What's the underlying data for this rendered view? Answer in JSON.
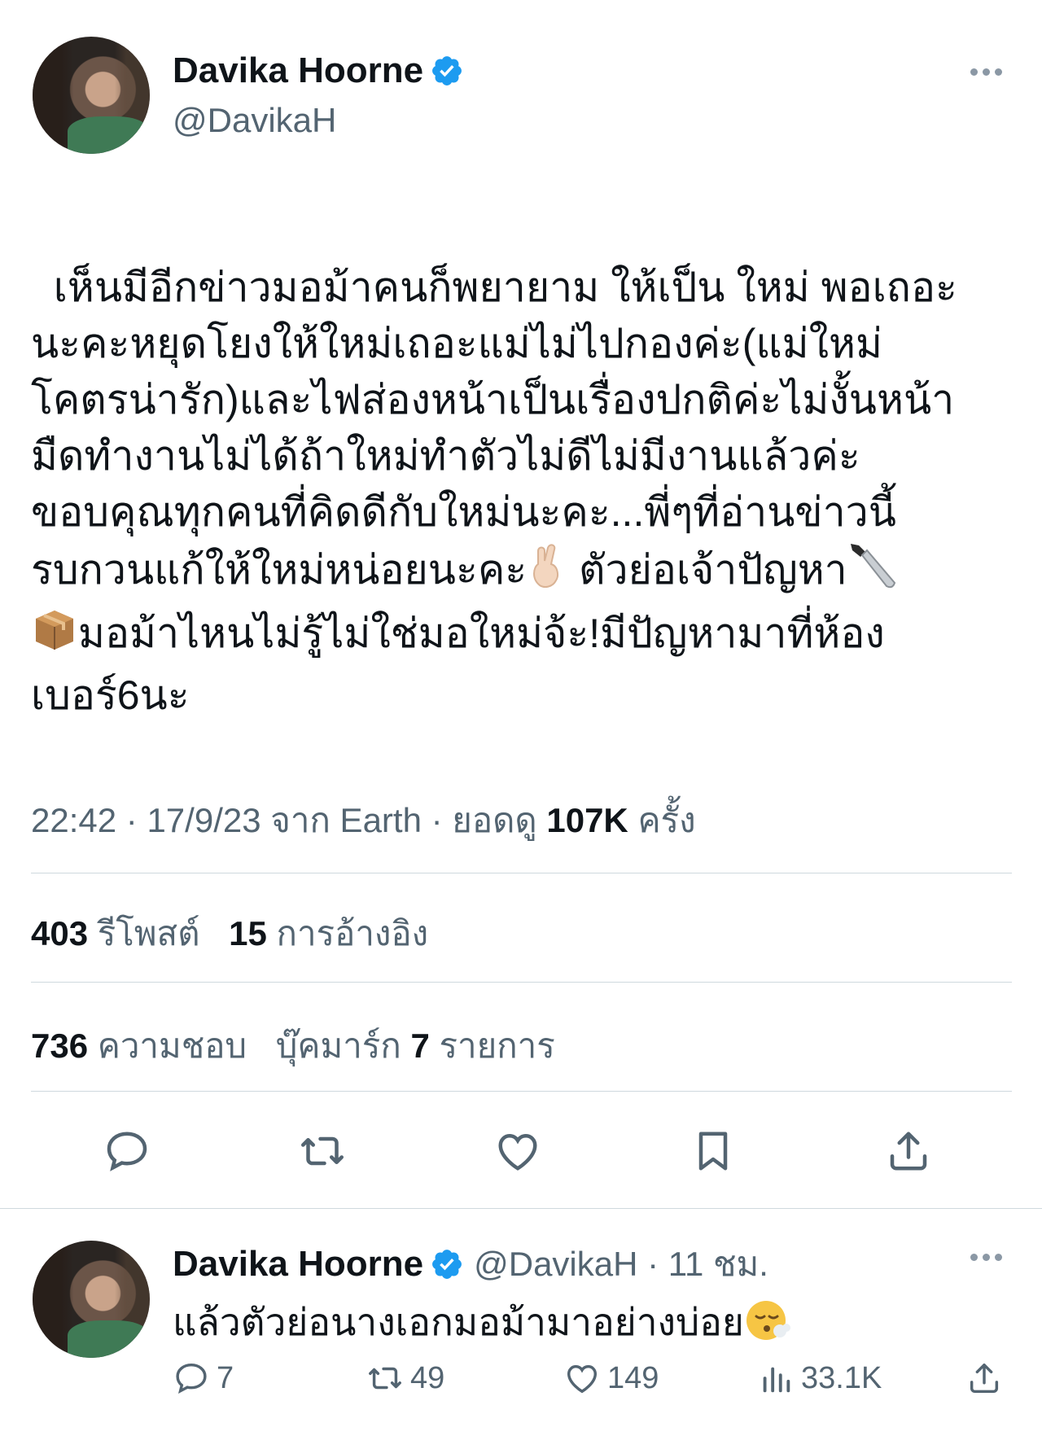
{
  "tweet": {
    "display_name": "Davika Hoorne",
    "handle": "@DavikaH",
    "text": "เห็นมีอีกข่าวมอม้าคนก็พยายาม ให้เป็น ใหม่ พอเถอะ\nนะคะหยุดโยงให้ใหม่เถอะแม่ไม่ไปกองค่ะ(แม่ใหม่\nโคตรน่ารัก)และไฟส่องหน้าเป็นเรื่องปกติค่ะไม่งั้นหน้า\nมืดทำงานไม่ได้ถ้าใหม่ทำตัวไม่ดีไม่มีงานแล้วค่ะ\nขอบคุณทุกคนที่คิดดีกับใหม่นะคะ...พี่ๆที่อ่านข่าวนี้\nรบกวนแก้ให้ใหม่หน่อยนะคะ",
    "text_line6_after_emoji": " ตัวย่อเจ้าปัญหา",
    "text_line7": "มอม้าไหนไม่รู้ไม่ใช่มอใหม่จ้ะ!มีปัญหามาที่ห้อง",
    "text_line8": "เบอร์6นะ",
    "emojis": [
      "crossed-fingers-emoji",
      "knife-emoji",
      "package-emoji"
    ],
    "meta": {
      "time": "22:42",
      "sep1": "·",
      "date": "17/9/23",
      "source": "จาก Earth",
      "sep2": "·",
      "views_label": "ยอดดู",
      "views": "107K",
      "views_unit": "ครั้ง"
    },
    "stats": {
      "reposts": "403",
      "reposts_label": "รีโพสต์",
      "quotes": "15",
      "quotes_label": "การอ้างอิง",
      "likes": "736",
      "likes_label": "ความชอบ",
      "bookmarks_label": "บุ๊คมาร์ก",
      "bookmarks": "7",
      "bookmarks_unit": "รายการ"
    },
    "actions": [
      "reply-icon",
      "repost-icon",
      "like-icon",
      "bookmark-icon",
      "share-icon"
    ]
  },
  "reply": {
    "display_name": "Davika Hoorne",
    "handle_time": "@DavikaH · 11 ชม.",
    "text": "แล้วตัวย่อนางเอกมอม้ามาอย่างบ่อย",
    "emoji": "face-exhaling-emoji",
    "counts": {
      "replies": "7",
      "reposts": "49",
      "likes": "149",
      "views": "33.1K"
    }
  },
  "colors": {
    "verified_blue": "#1d9bf0",
    "text_primary": "#0f1419",
    "text_secondary": "#536471",
    "divider": "#cfd9de"
  }
}
